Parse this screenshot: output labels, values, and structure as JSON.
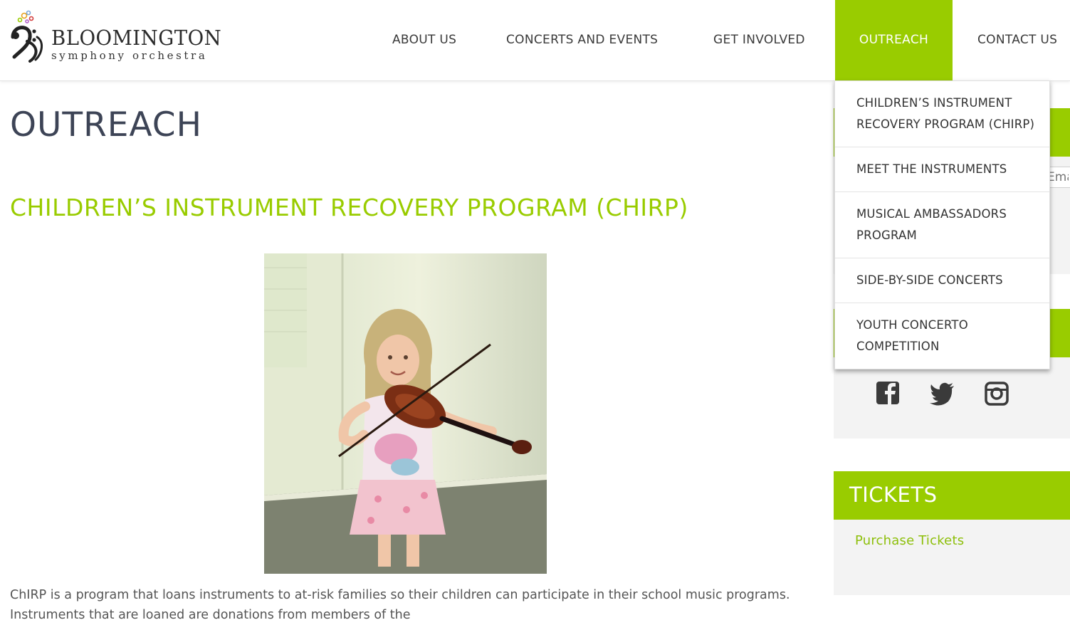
{
  "brand": {
    "name": "BLOOMINGTON",
    "tagline": "symphony orchestra"
  },
  "nav": {
    "items": [
      {
        "label": "ABOUT US"
      },
      {
        "label": "CONCERTS AND EVENTS"
      },
      {
        "label": "GET INVOLVED"
      },
      {
        "label": "OUTREACH",
        "active": true
      },
      {
        "label": "CONTACT US"
      }
    ],
    "dropdown": [
      {
        "label": "CHILDREN’S INSTRUMENT RECOVERY PROGRAM (CHIRP)"
      },
      {
        "label": "MEET THE INSTRUMENTS"
      },
      {
        "label": "MUSICAL AMBASSADORS PROGRAM"
      },
      {
        "label": "SIDE-BY-SIDE CONCERTS"
      },
      {
        "label": "YOUTH CONCERTO COMPETITION"
      }
    ]
  },
  "main": {
    "page_title": "OUTREACH",
    "section_title": "CHILDREN’S INSTRUMENT RECOVERY PROGRAM (CHIRP)",
    "body_text": "ChIRP is a program that loans instruments to at-risk families so their children can participate in their school music programs. Instruments that are loaned are donations from members of the"
  },
  "sidebar": {
    "newsletter": {
      "email_placeholder": "Email Address"
    },
    "social": [
      "facebook-icon",
      "twitter-icon",
      "instagram-icon"
    ],
    "tickets": {
      "title": "TICKETS",
      "link_label": "Purchase Tickets"
    }
  },
  "colors": {
    "accent": "#99cc00",
    "title": "#3d4456",
    "sidebar_bg": "#f3f3f3"
  }
}
